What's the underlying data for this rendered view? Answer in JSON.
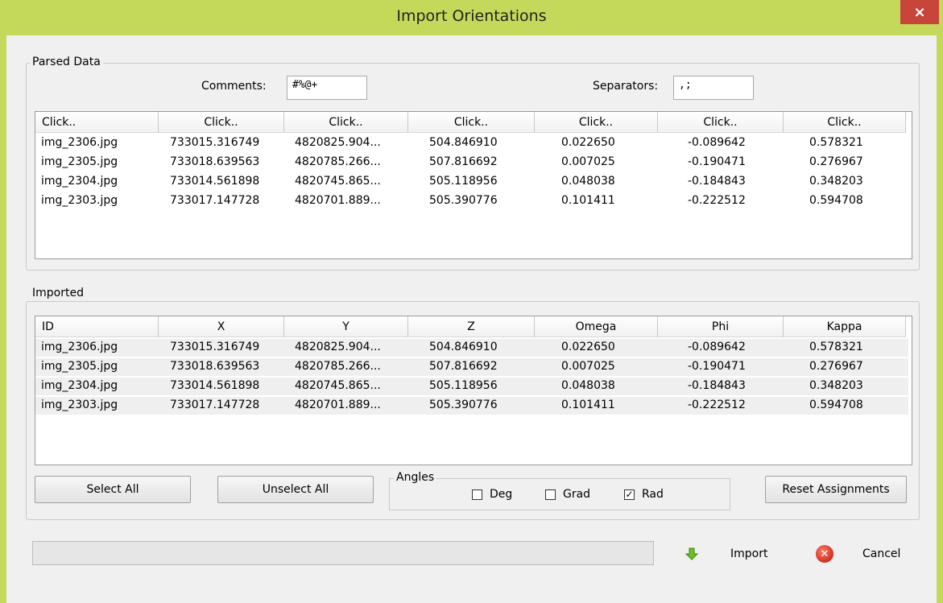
{
  "window": {
    "title": "Import Orientations",
    "close_glyph": "×"
  },
  "parsed": {
    "group_label": "Parsed Data",
    "comments_label": "Comments:",
    "comments_value": "#%@+",
    "separators_label": "Separators:",
    "separators_value": ",;",
    "headers": [
      "Click..",
      "Click..",
      "Click..",
      "Click..",
      "Click..",
      "Click..",
      "Click.."
    ],
    "rows": [
      [
        "img_2306.jpg",
        "733015.316749",
        "4820825.904...",
        "504.846910",
        "0.022650",
        "-0.089642",
        "0.578321"
      ],
      [
        "img_2305.jpg",
        "733018.639563",
        "4820785.266...",
        "507.816692",
        "0.007025",
        "-0.190471",
        "0.276967"
      ],
      [
        "img_2304.jpg",
        "733014.561898",
        "4820745.865...",
        "505.118956",
        "0.048038",
        "-0.184843",
        "0.348203"
      ],
      [
        "img_2303.jpg",
        "733017.147728",
        "4820701.889...",
        "505.390776",
        "0.101411",
        "-0.222512",
        "0.594708"
      ]
    ]
  },
  "imported": {
    "group_label": "Imported",
    "headers": [
      "ID",
      "X",
      "Y",
      "Z",
      "Omega",
      "Phi",
      "Kappa"
    ],
    "rows": [
      [
        "img_2306.jpg",
        "733015.316749",
        "4820825.904...",
        "504.846910",
        "0.022650",
        "-0.089642",
        "0.578321"
      ],
      [
        "img_2305.jpg",
        "733018.639563",
        "4820785.266...",
        "507.816692",
        "0.007025",
        "-0.190471",
        "0.276967"
      ],
      [
        "img_2304.jpg",
        "733014.561898",
        "4820745.865...",
        "505.118956",
        "0.048038",
        "-0.184843",
        "0.348203"
      ],
      [
        "img_2303.jpg",
        "733017.147728",
        "4820701.889...",
        "505.390776",
        "0.101411",
        "-0.222512",
        "0.594708"
      ]
    ],
    "select_all_label": "Select All",
    "unselect_all_label": "Unselect All",
    "angles": {
      "group_label": "Angles",
      "options": [
        {
          "label": "Deg",
          "checked": false
        },
        {
          "label": "Grad",
          "checked": false
        },
        {
          "label": "Rad",
          "checked": true
        }
      ]
    },
    "reset_label": "Reset Assignments"
  },
  "footer": {
    "progress": 0,
    "import_label": "Import",
    "import_icon": "green-down-arrow-icon",
    "cancel_label": "Cancel",
    "cancel_icon": "red-x-circle-icon"
  },
  "colors": {
    "titlebar": "#c4d95a",
    "close": "#c7453a",
    "dialog": "#f0f0f0"
  }
}
